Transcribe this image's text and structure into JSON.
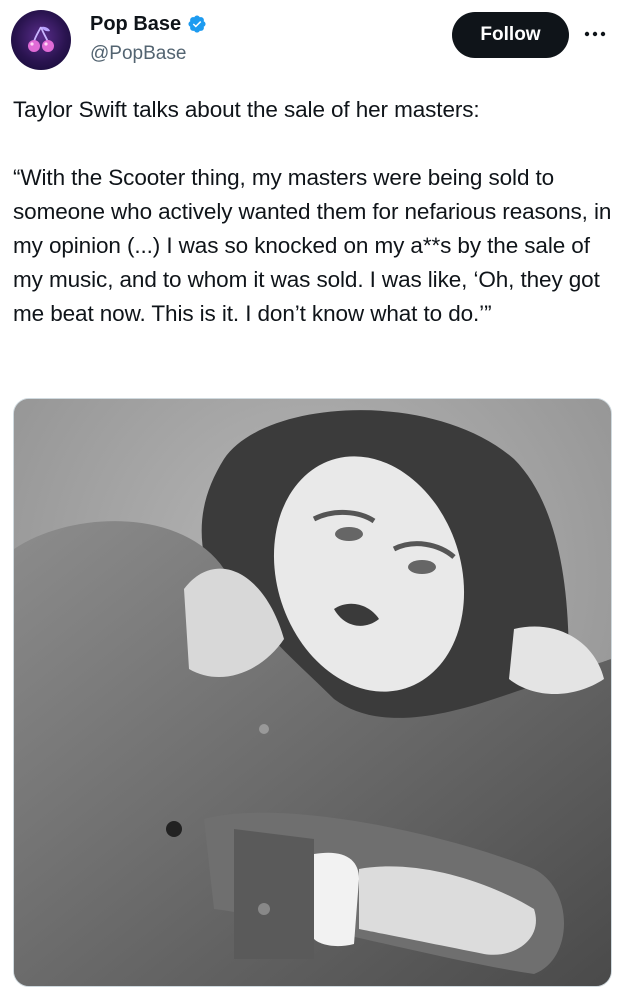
{
  "user": {
    "display_name": "Pop Base",
    "handle": "@PopBase"
  },
  "actions": {
    "follow_label": "Follow",
    "more_icon": "more-horizontal-icon"
  },
  "tweet": {
    "text": "Taylor Swift talks about the sale of her masters:\n\n“With the Scooter thing, my masters were being sold to someone who actively wanted them for nefarious reasons, in my opinion (...) I was so knocked on my a**s by the sale of my music, and to whom it was sold. I was like, ‘Oh, they got me beat now. This is it. I don’t know what to do.’”"
  },
  "colors": {
    "verified": "#1d9bf0",
    "follow_bg": "#0f1419",
    "handle": "#536471"
  }
}
